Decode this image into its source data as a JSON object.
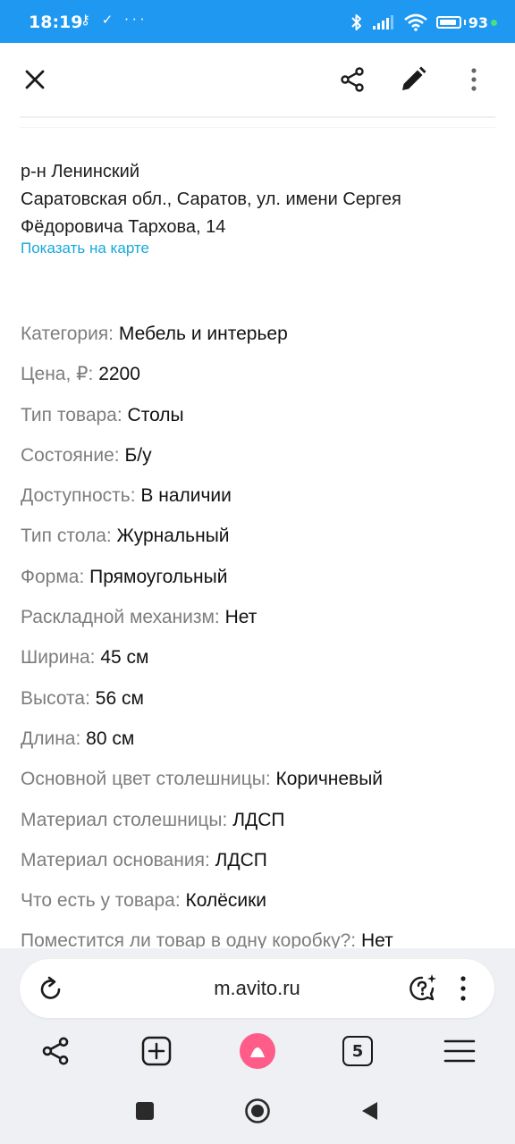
{
  "status_bar": {
    "time": "18:19",
    "left_icons": "⚷ ✓ ···",
    "battery": "93",
    "battery_level": 0.93
  },
  "top_bar": {
    "icons": [
      "close-icon",
      "share-icon",
      "edit-icon",
      "more-vertical-icon"
    ]
  },
  "address": {
    "district": "р-н Ленинский",
    "line1": "Саратовская обл., Саратов, ул. имени Сергея",
    "line2": "Фёдоровича Тархова, 14",
    "map_link": "Показать на карте"
  },
  "params": [
    {
      "label": "Категория: ",
      "value": "Мебель и интерьер"
    },
    {
      "label": "Цена, ₽: ",
      "value": "2200"
    },
    {
      "label": "Тип товара: ",
      "value": "Столы"
    },
    {
      "label": "Состояние: ",
      "value": "Б/у"
    },
    {
      "label": "Доступность: ",
      "value": "В наличии"
    },
    {
      "label": "Тип стола: ",
      "value": "Журнальный"
    },
    {
      "label": "Форма: ",
      "value": "Прямоугольный"
    },
    {
      "label": "Раскладной механизм: ",
      "value": "Нет"
    },
    {
      "label": "Ширина: ",
      "value": "45 см"
    },
    {
      "label": "Высота: ",
      "value": "56 см"
    },
    {
      "label": "Длина: ",
      "value": "80 см"
    },
    {
      "label": "Основной цвет столешницы: ",
      "value": "Коричневый"
    },
    {
      "label": "Материал столешницы: ",
      "value": "ЛДСП"
    },
    {
      "label": "Материал основания: ",
      "value": "ЛДСП"
    },
    {
      "label": "Что есть у товара: ",
      "value": "Колёсики"
    },
    {
      "label": "Поместится ли товар в одну коробку?: ",
      "value": "Нет"
    }
  ],
  "browser": {
    "url": "m.avito.ru",
    "tab_count": "5",
    "alice_color": "#ff5c8a"
  },
  "colors": {
    "status_bar": "#1e98f0",
    "link": "#16a8db"
  }
}
